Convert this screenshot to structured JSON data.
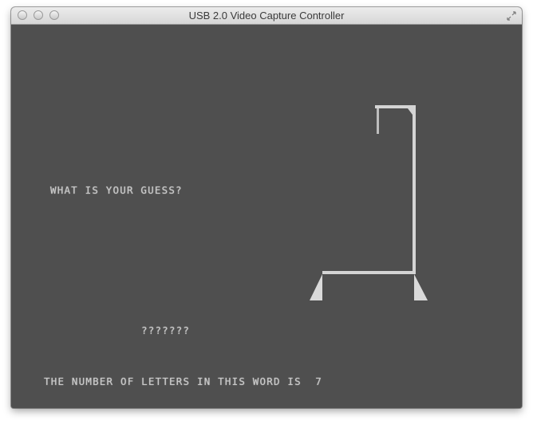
{
  "window": {
    "title": "USB 2.0 Video Capture Controller"
  },
  "game": {
    "prompt": "WHAT IS YOUR GUESS?",
    "masked_word": "???????",
    "letter_count_message": "THE NUMBER OF LETTERS IN THIS WORD IS  7"
  },
  "colors": {
    "screen_background": "#4f4f4f",
    "crt_text": "#c9c9c9",
    "gallows": "#d4d4d4"
  }
}
